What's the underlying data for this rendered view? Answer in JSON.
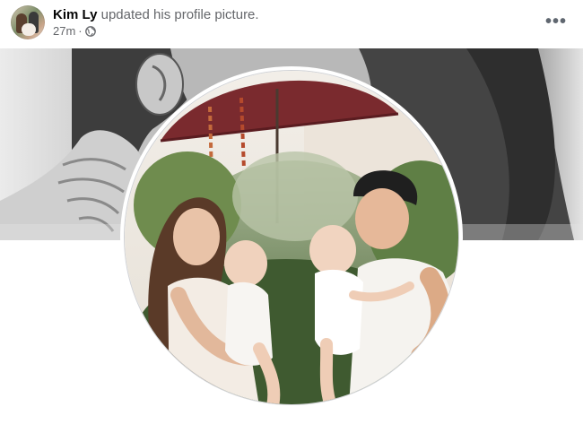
{
  "post": {
    "author": "Kim Ly",
    "action": "updated his profile picture.",
    "time": "27m",
    "separator": "·",
    "privacy_icon": "globe-icon",
    "menu_icon": "more-options-icon"
  },
  "colors": {
    "name_text": "#050505",
    "secondary_text": "#65676b",
    "background": "#ffffff",
    "umbrella": "#7a2a2e"
  }
}
